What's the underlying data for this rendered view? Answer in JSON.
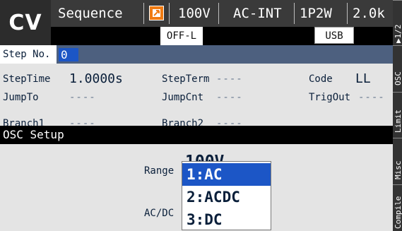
{
  "header": {
    "mode": "CV",
    "title": "Sequence",
    "voltage": "100V",
    "source": "AC-INT",
    "wiring": "1P2W",
    "range": "2.0k",
    "output_badge": "OFF-L",
    "interface_badge": "USB",
    "colors": {
      "lock_icon": "#f07b12",
      "selection": "#1c56c6"
    }
  },
  "softkeys": [
    {
      "label": "▶1/2",
      "icon": "triangle-right-icon"
    },
    {
      "label": "OSC"
    },
    {
      "label": "Limit"
    },
    {
      "label": "Misc"
    },
    {
      "label": "Compile"
    }
  ],
  "step": {
    "label": "Step No.",
    "value": "0"
  },
  "fields": {
    "step_time_label": "StepTime",
    "step_time_value": "1.0000s",
    "step_term_label": "StepTerm",
    "step_term_value": "----",
    "code_label": "Code",
    "code_value": "LL",
    "jump_to_label": "JumpTo",
    "jump_to_value": "----",
    "jump_cnt_label": "JumpCnt",
    "jump_cnt_value": "----",
    "trig_out_label": "TrigOut",
    "trig_out_value": "----",
    "branch1_label": "Branch1",
    "branch1_value": "----",
    "branch2_label": "Branch2",
    "branch2_value": "----"
  },
  "osc_setup": {
    "title": "OSC Setup",
    "range_label": "Range",
    "range_value": "100V",
    "acdc_label": "AC/DC",
    "dropdown_options": [
      "1:AC",
      "2:ACDC",
      "3:DC"
    ],
    "selected_index": 0
  }
}
